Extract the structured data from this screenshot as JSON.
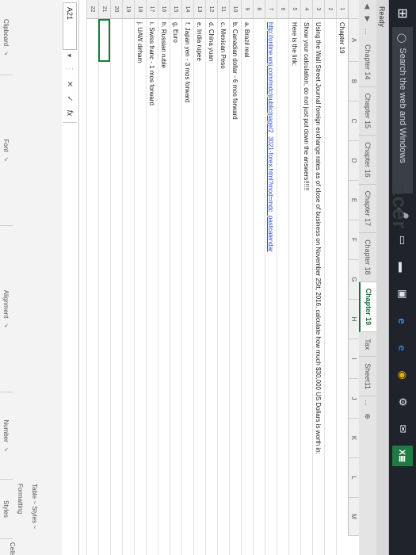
{
  "taskbar": {
    "search_placeholder": "Search the web and Windows",
    "apps": [
      "microphone-icon",
      "task-view-icon",
      "file-explorer-icon",
      "store-icon",
      "edge-icon",
      "ie-icon",
      "chrome-icon",
      "settings-icon",
      "mail-icon",
      "excel-icon"
    ],
    "excel_label": "X≣"
  },
  "status": {
    "ready": "Ready"
  },
  "sheet_tabs": {
    "ellipsis_left": "...",
    "tabs": [
      {
        "label": "Chapter 14"
      },
      {
        "label": "Chapter 15"
      },
      {
        "label": "Chapter 16"
      },
      {
        "label": "Chapter 17"
      },
      {
        "label": "Chapter 18"
      },
      {
        "label": "Chapter 19",
        "active": true
      },
      {
        "label": "Tax"
      },
      {
        "label": "Sheet11"
      }
    ],
    "ellipsis_right": "..."
  },
  "formula_bar": {
    "name_box": "A21",
    "fx": "fx"
  },
  "ribbon": {
    "group_labels": [
      "Clipboard",
      "Font",
      "Alignment",
      "Number",
      "Styles"
    ],
    "styles_text": "Table ~ Styles ~",
    "formatting_text": "Formatting",
    "cells_text": "Cells"
  },
  "columns": [
    "A",
    "B",
    "C",
    "D",
    "E",
    "F",
    "G",
    "H",
    "I",
    "J",
    "K",
    "L",
    "M"
  ],
  "rows": [
    {
      "num": "1",
      "text": "Chapter 19"
    },
    {
      "num": "2",
      "text": ""
    },
    {
      "num": "3",
      "text": "Using the Wall Street Journal foreign exchange rates as of close of business on November 25tt, 2016, calculate how much $30,000 US Dollars is worth in:"
    },
    {
      "num": "4",
      "text": "Show your calculation, do not just put down the answers!!!!!!"
    },
    {
      "num": "5",
      "text": "Here is the link:"
    },
    {
      "num": "6",
      "text": ""
    },
    {
      "num": "7",
      "text": "http://online.wsj.com/mdc/public/page/2_3021-forex.html?mod=mdc_pastcalendar",
      "link": true
    },
    {
      "num": "8",
      "text": ""
    },
    {
      "num": "9",
      "text": "a. Brazil real"
    },
    {
      "num": "10",
      "text": "b. Canadian dollar - 6 mos forward"
    },
    {
      "num": "11",
      "text": "c. Mexican Peso"
    },
    {
      "num": "12",
      "text": "d. China yuan"
    },
    {
      "num": "13",
      "text": "e. India rupee"
    },
    {
      "num": "14",
      "text": "f. Japan yen - 3 mos forward"
    },
    {
      "num": "15",
      "text": "g. Euro"
    },
    {
      "num": "16",
      "text": "h. Russian ruble"
    },
    {
      "num": "17",
      "text": "i. Swiss franc - 1 mos forward"
    },
    {
      "num": "18",
      "text": "j. UAW dirham"
    },
    {
      "num": "19",
      "text": ""
    },
    {
      "num": "20",
      "text": ""
    },
    {
      "num": "21",
      "text": "",
      "selected": true
    },
    {
      "num": "22",
      "text": ""
    }
  ],
  "bezel_logo": "acer",
  "colors": {
    "excel_green": "#1b7a3b",
    "taskbar": "#20232b",
    "link": "#1f4fd1"
  }
}
